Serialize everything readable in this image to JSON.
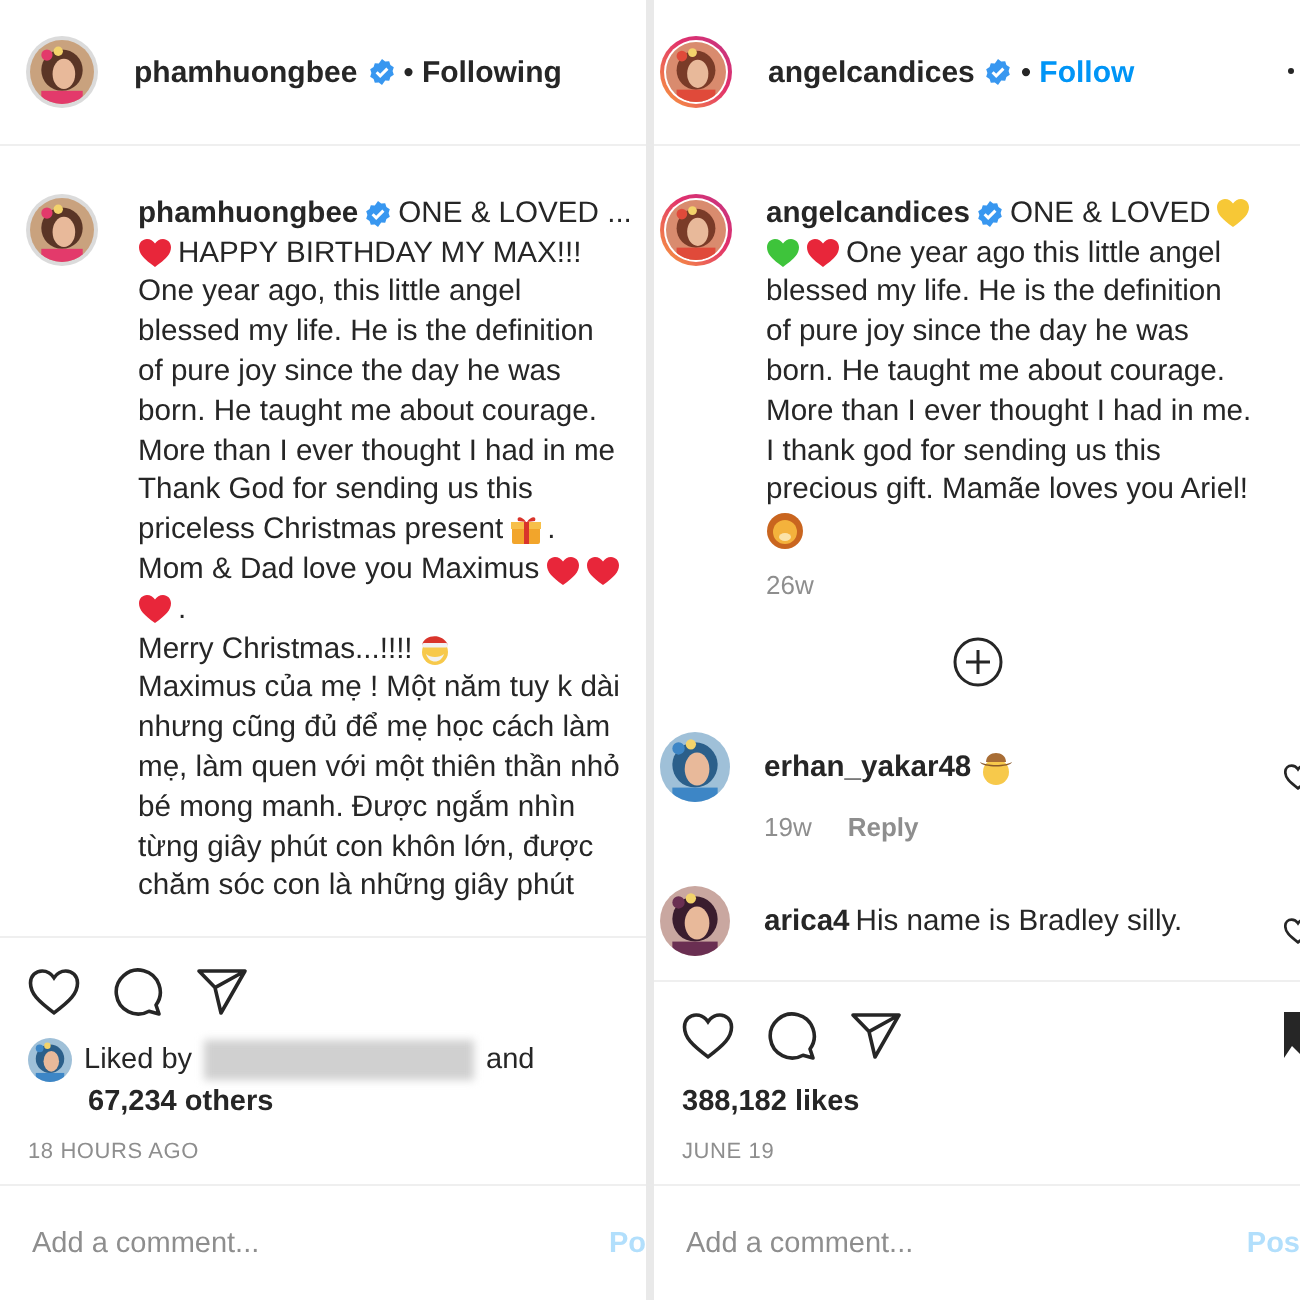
{
  "posts": [
    {
      "username": "phamhuongbee",
      "verified": true,
      "story_ring": false,
      "separator": "•",
      "follow": "Following",
      "following": true,
      "caption": [
        [
          {
            "kind": "username",
            "text": "phamhuongbee"
          },
          {
            "kind": "verified"
          },
          {
            "kind": "text",
            "text": "ONE & LOVED ..."
          }
        ],
        [
          {
            "kind": "heart",
            "color": "#e8263a"
          },
          {
            "kind": "text",
            "text": "HAPPY BIRTHDAY MY MAX!!!"
          }
        ],
        [
          {
            "kind": "text",
            "text": "One year ago, this little angel"
          }
        ],
        [
          {
            "kind": "text",
            "text": "blessed my life. He is the definition"
          }
        ],
        [
          {
            "kind": "text",
            "text": "of pure joy since the day he was"
          }
        ],
        [
          {
            "kind": "text",
            "text": "born. He taught me about courage."
          }
        ],
        [
          {
            "kind": "text",
            "text": "More than I ever thought I had in me"
          }
        ],
        [
          {
            "kind": "text",
            "text": "Thank God for sending us this"
          }
        ],
        [
          {
            "kind": "text",
            "text": "priceless Christmas present"
          },
          {
            "kind": "gift"
          },
          {
            "kind": "text",
            "text": "."
          }
        ],
        [
          {
            "kind": "text",
            "text": "Mom & Dad love you Maximus"
          },
          {
            "kind": "heart",
            "color": "#e8263a"
          },
          {
            "kind": "heart",
            "color": "#e8263a"
          }
        ],
        [
          {
            "kind": "heart",
            "color": "#e8263a"
          },
          {
            "kind": "text",
            "text": "."
          }
        ],
        [
          {
            "kind": "text",
            "text": "Merry Christmas...!!!!"
          },
          {
            "kind": "santa"
          }
        ],
        [
          {
            "kind": "text",
            "text": "Maximus của mẹ ! Một năm tuy k dài"
          }
        ],
        [
          {
            "kind": "text",
            "text": "nhưng cũng đủ để mẹ học cách làm"
          }
        ],
        [
          {
            "kind": "text",
            "text": "mẹ, làm quen với một thiên thần nhỏ"
          }
        ],
        [
          {
            "kind": "text",
            "text": "bé mong manh. Được ngắm nhìn"
          }
        ],
        [
          {
            "kind": "text",
            "text": "từng giây phút con khôn lớn, được"
          }
        ],
        [
          {
            "kind": "text",
            "text": "chăm sóc con là những giây phút"
          }
        ]
      ],
      "likes": {
        "kind": "liked_by",
        "prefix": "Liked by",
        "suffix": "and",
        "others": "67,234 others"
      },
      "date": "18 HOURS AGO",
      "comment_placeholder": "Add a comment...",
      "post_button": "Po",
      "post_disabled": true
    },
    {
      "username": "angelcandices",
      "verified": true,
      "story_ring": true,
      "separator": "•",
      "follow": "Follow",
      "following": false,
      "caption": [
        [
          {
            "kind": "username",
            "text": "angelcandices"
          },
          {
            "kind": "verified"
          },
          {
            "kind": "text",
            "text": "ONE & LOVED"
          },
          {
            "kind": "heart",
            "color": "#f7c836"
          }
        ],
        [
          {
            "kind": "heart",
            "color": "#3ec43b"
          },
          {
            "kind": "heart",
            "color": "#e8263a"
          },
          {
            "kind": "text",
            "text": "One year ago this little angel"
          }
        ],
        [
          {
            "kind": "text",
            "text": "blessed my life. He is the definition"
          }
        ],
        [
          {
            "kind": "text",
            "text": "of pure joy since the day he was"
          }
        ],
        [
          {
            "kind": "text",
            "text": "born. He taught me about courage."
          }
        ],
        [
          {
            "kind": "text",
            "text": "More than I ever thought I had in me."
          }
        ],
        [
          {
            "kind": "text",
            "text": "I thank god for sending us this"
          }
        ],
        [
          {
            "kind": "text",
            "text": "precious gift. Mamãe loves you Ariel!"
          }
        ],
        [
          {
            "kind": "lion"
          }
        ]
      ],
      "age": "26w",
      "comments": [
        {
          "username": "erhan_yakar48",
          "segments": [
            {
              "kind": "cowboy"
            }
          ],
          "age": "19w",
          "reply": "Reply"
        },
        {
          "username": "arica4",
          "segments": [
            {
              "kind": "text",
              "text": "His name is Bradley silly."
            }
          ]
        }
      ],
      "likes": {
        "kind": "count",
        "text": "388,182 likes"
      },
      "date": "JUNE 19",
      "comment_placeholder": "Add a comment...",
      "post_button": "Pos",
      "post_disabled": true
    }
  ]
}
